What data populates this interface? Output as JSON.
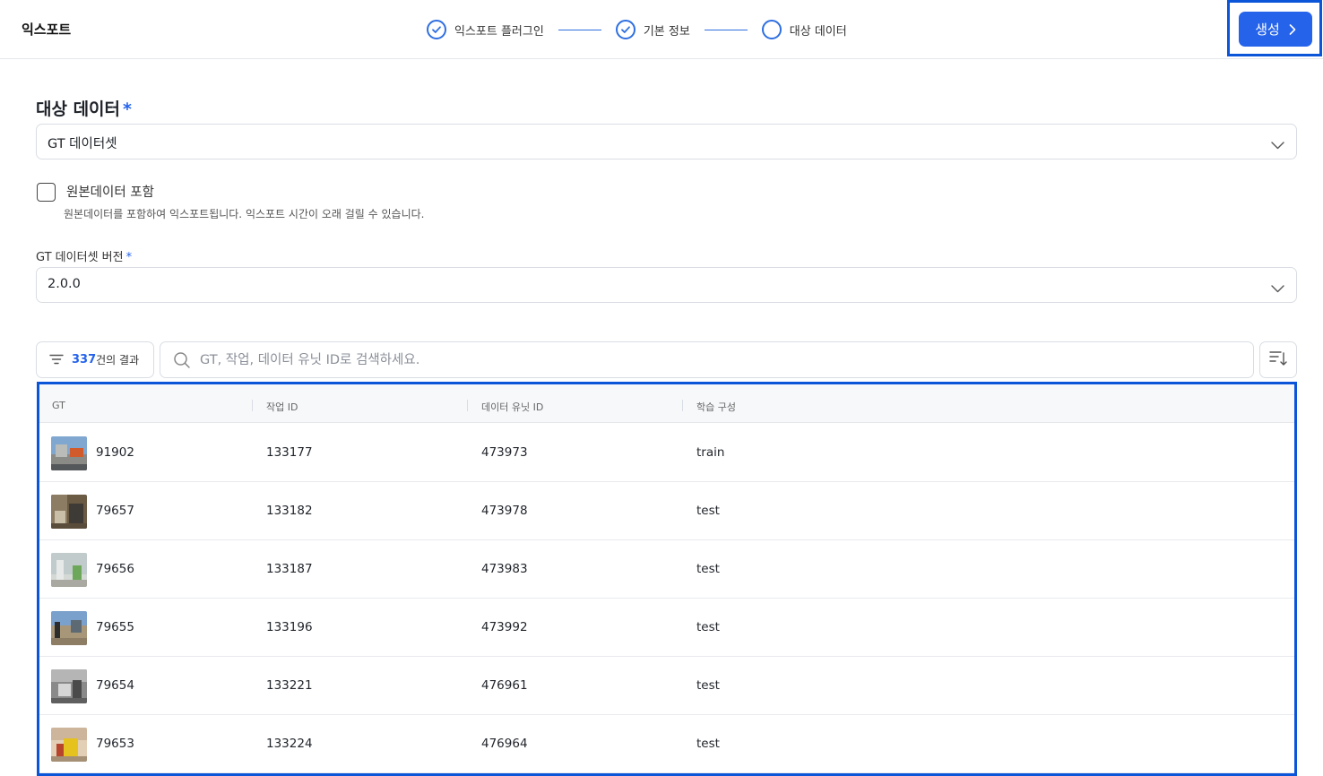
{
  "header": {
    "title": "익스포트",
    "steps": [
      {
        "label": "익스포트 플러그인",
        "status": "done"
      },
      {
        "label": "기본 정보",
        "status": "done"
      },
      {
        "label": "대상 데이터",
        "status": "current"
      }
    ],
    "create_label": "생성"
  },
  "form": {
    "section_title": "대상 데이터",
    "required_mark": "*",
    "dataset_select": {
      "value": "GT 데이터셋"
    },
    "include_original": {
      "label": "원본데이터 포함",
      "help": "원본데이터를 포함하여 익스포트됩니다. 익스포트 시간이 오래 걸릴 수 있습니다.",
      "checked": false
    },
    "version_label": "GT 데이터셋 버전",
    "version_select": {
      "value": "2.0.0"
    }
  },
  "results": {
    "count": "337",
    "suffix": "건의 결과",
    "search_placeholder": "GT, 작업, 데이터 유닛 ID로 검색하세요."
  },
  "table": {
    "headers": [
      "GT",
      "작업 ID",
      "데이터 유닛 ID",
      "학습 구성"
    ],
    "rows": [
      {
        "gt": "91902",
        "task_id": "133177",
        "unit_id": "473973",
        "split": "train"
      },
      {
        "gt": "79657",
        "task_id": "133182",
        "unit_id": "473978",
        "split": "test"
      },
      {
        "gt": "79656",
        "task_id": "133187",
        "unit_id": "473983",
        "split": "test"
      },
      {
        "gt": "79655",
        "task_id": "133196",
        "unit_id": "473992",
        "split": "test"
      },
      {
        "gt": "79654",
        "task_id": "133221",
        "unit_id": "476961",
        "split": "test"
      },
      {
        "gt": "79653",
        "task_id": "133224",
        "unit_id": "476964",
        "split": "test"
      }
    ]
  },
  "colors": {
    "accent": "#2563eb",
    "highlight": "#0b55d9"
  },
  "icons": {
    "step_done": "check-circle-icon",
    "step_current": "circle-icon",
    "filter": "filter-lines-icon",
    "search": "search-icon",
    "sort": "sort-icon",
    "chevron": "chevron-down-icon"
  }
}
